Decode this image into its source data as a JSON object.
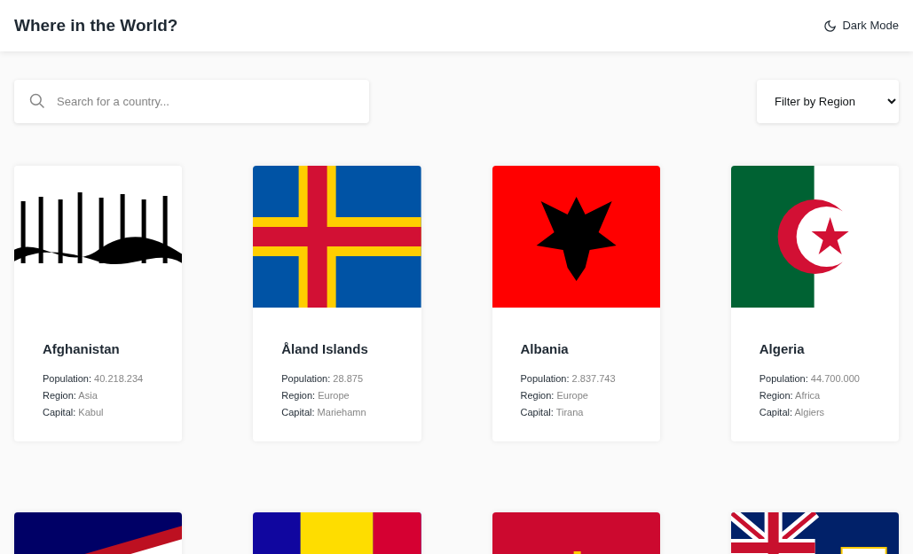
{
  "header": {
    "title": "Where in the World?",
    "theme_toggle": "Dark Mode"
  },
  "search": {
    "placeholder": "Search for a country..."
  },
  "filter": {
    "value": "Filter by Region"
  },
  "cards": [
    {
      "flag": {
        "kind": "picture"
      },
      "name": "Afghanistan",
      "facts": [
        {
          "label": "Population:",
          "value": "40.218.234"
        },
        {
          "label": "Region:",
          "value": "Asia"
        },
        {
          "label": "Capital:",
          "value": "Kabul"
        }
      ]
    },
    {
      "flag": {
        "kind": "picture"
      },
      "name": "Åland Islands",
      "facts": [
        {
          "label": "Population:",
          "value": "28.875"
        },
        {
          "label": "Region:",
          "value": "Europe"
        },
        {
          "label": "Capital:",
          "value": "Mariehamn"
        }
      ]
    },
    {
      "flag": {
        "kind": "picture"
      },
      "name": "Albania",
      "facts": [
        {
          "label": "Population:",
          "value": "2.837.743"
        },
        {
          "label": "Region:",
          "value": "Europe"
        },
        {
          "label": "Capital:",
          "value": "Tirana"
        }
      ]
    },
    {
      "flag": {
        "kind": "picture"
      },
      "name": "Algeria",
      "facts": [
        {
          "label": "Population:",
          "value": "44.700.000"
        },
        {
          "label": "Region:",
          "value": "Africa"
        },
        {
          "label": "Capital:",
          "value": "Algiers"
        }
      ]
    },
    {
      "flag": {
        "kind": "picture"
      }
    },
    {
      "flag": {
        "kind": "picture"
      }
    },
    {
      "flag": {
        "kind": "picture"
      }
    },
    {
      "flag": {
        "kind": "picture"
      }
    }
  ]
}
